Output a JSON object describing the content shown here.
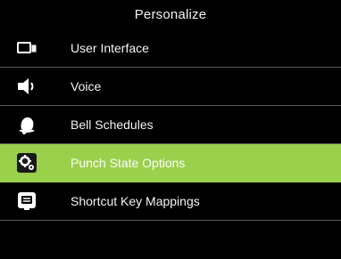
{
  "header": {
    "title": "Personalize"
  },
  "colors": {
    "background": "#000000",
    "selected_row": "#9ad04c",
    "divider": "#5a5a5a",
    "text": "#ffffff"
  },
  "menu": {
    "selected_index": 3,
    "items": [
      {
        "label": "User Interface",
        "icon": "display-icon"
      },
      {
        "label": "Voice",
        "icon": "speaker-icon"
      },
      {
        "label": "Bell Schedules",
        "icon": "bell-icon"
      },
      {
        "label": "Punch State Options",
        "icon": "gears-icon"
      },
      {
        "label": "Shortcut Key Mappings",
        "icon": "keyboard-icon"
      }
    ]
  }
}
